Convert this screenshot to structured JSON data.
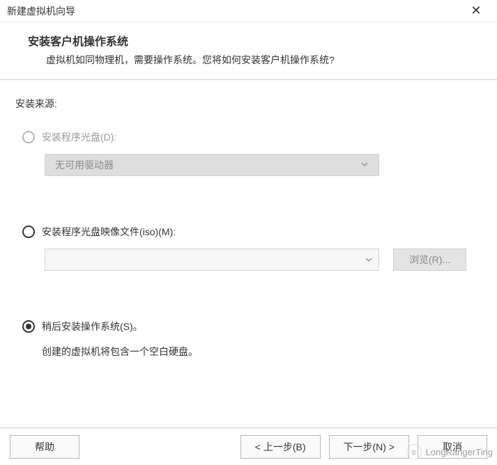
{
  "window": {
    "title": "新建虚拟机向导"
  },
  "header": {
    "heading": "安装客户机操作系统",
    "description": "虚拟机如同物理机，需要操作系统。您将如何安装客户机操作系统?"
  },
  "source": {
    "label": "安装来源:",
    "options": {
      "disc": {
        "label": "安装程序光盘(D):",
        "dropdown_value": "无可用驱动器",
        "enabled": false,
        "selected": false
      },
      "iso": {
        "label": "安装程序光盘映像文件(iso)(M):",
        "value": "",
        "browse_label": "浏览(R)...",
        "enabled": true,
        "selected": false
      },
      "later": {
        "label": "稍后安装操作系统(S)。",
        "hint": "创建的虚拟机将包含一个空白硬盘。",
        "selected": true
      }
    }
  },
  "footer": {
    "help": "帮助",
    "back": "< 上一步(B)",
    "next": "下一步(N) >",
    "cancel": "取消"
  },
  "watermark": {
    "text": "LongRangerTing"
  }
}
